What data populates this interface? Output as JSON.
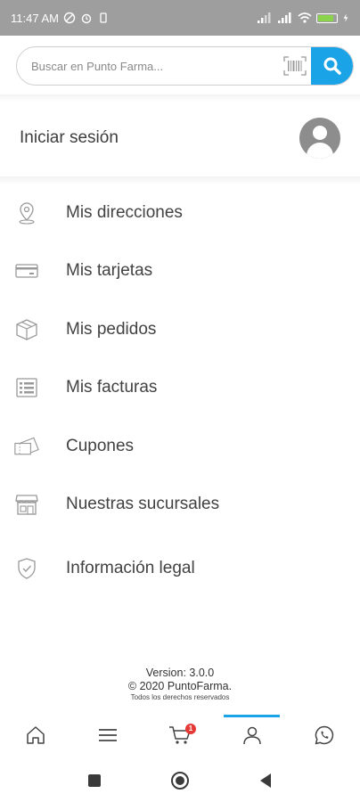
{
  "status_bar": {
    "time": "11:47 AM",
    "battery_level": 0.85
  },
  "search": {
    "placeholder": "Buscar en Punto Farma..."
  },
  "account": {
    "login_label": "Iniciar sesión"
  },
  "menu": {
    "items": [
      {
        "label": "Mis direcciones",
        "icon": "location-pin-icon"
      },
      {
        "label": "Mis tarjetas",
        "icon": "credit-card-icon"
      },
      {
        "label": "Mis pedidos",
        "icon": "package-icon"
      },
      {
        "label": "Mis facturas",
        "icon": "invoice-icon"
      },
      {
        "label": "Cupones",
        "icon": "coupon-icon"
      },
      {
        "label": "Nuestras sucursales",
        "icon": "store-icon"
      },
      {
        "label": "Información legal",
        "icon": "shield-check-icon"
      }
    ]
  },
  "footer": {
    "version": "Version: 3.0.0",
    "copyright": "© 2020 PuntoFarma.",
    "rights": "Todos los derechos reservados"
  },
  "bottom_nav": {
    "cart_badge": "1",
    "active": "profile"
  },
  "colors": {
    "accent": "#1aa3e6",
    "badge": "#e53935",
    "status_bar": "#9e9e9e"
  }
}
